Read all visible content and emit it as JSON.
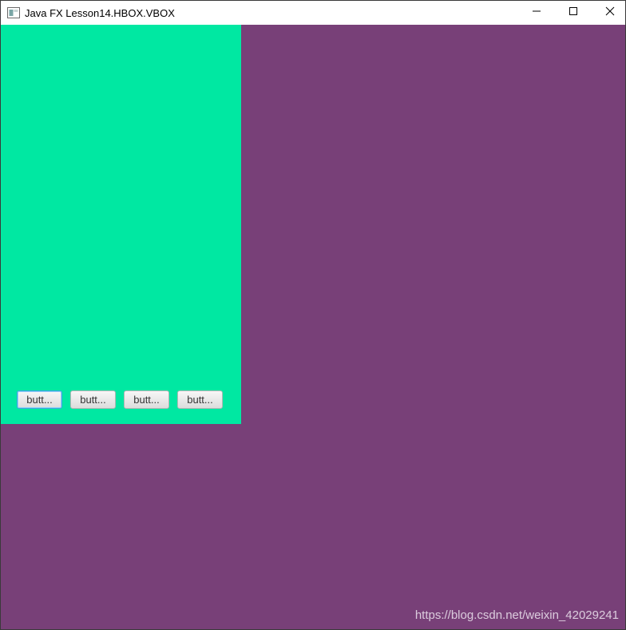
{
  "window": {
    "title": "Java FX Lesson14.HBOX.VBOX",
    "icon": "java-app-icon",
    "controls": {
      "minimize_icon": "minimize-icon",
      "maximize_icon": "maximize-icon",
      "close_icon": "close-icon"
    }
  },
  "colors": {
    "background": "#784078",
    "pane": "#00e8a2"
  },
  "buttons": [
    {
      "label": "butt...",
      "focused": true
    },
    {
      "label": "butt...",
      "focused": false
    },
    {
      "label": "butt...",
      "focused": false
    },
    {
      "label": "butt...",
      "focused": false
    }
  ],
  "watermark": "https://blog.csdn.net/weixin_42029241"
}
